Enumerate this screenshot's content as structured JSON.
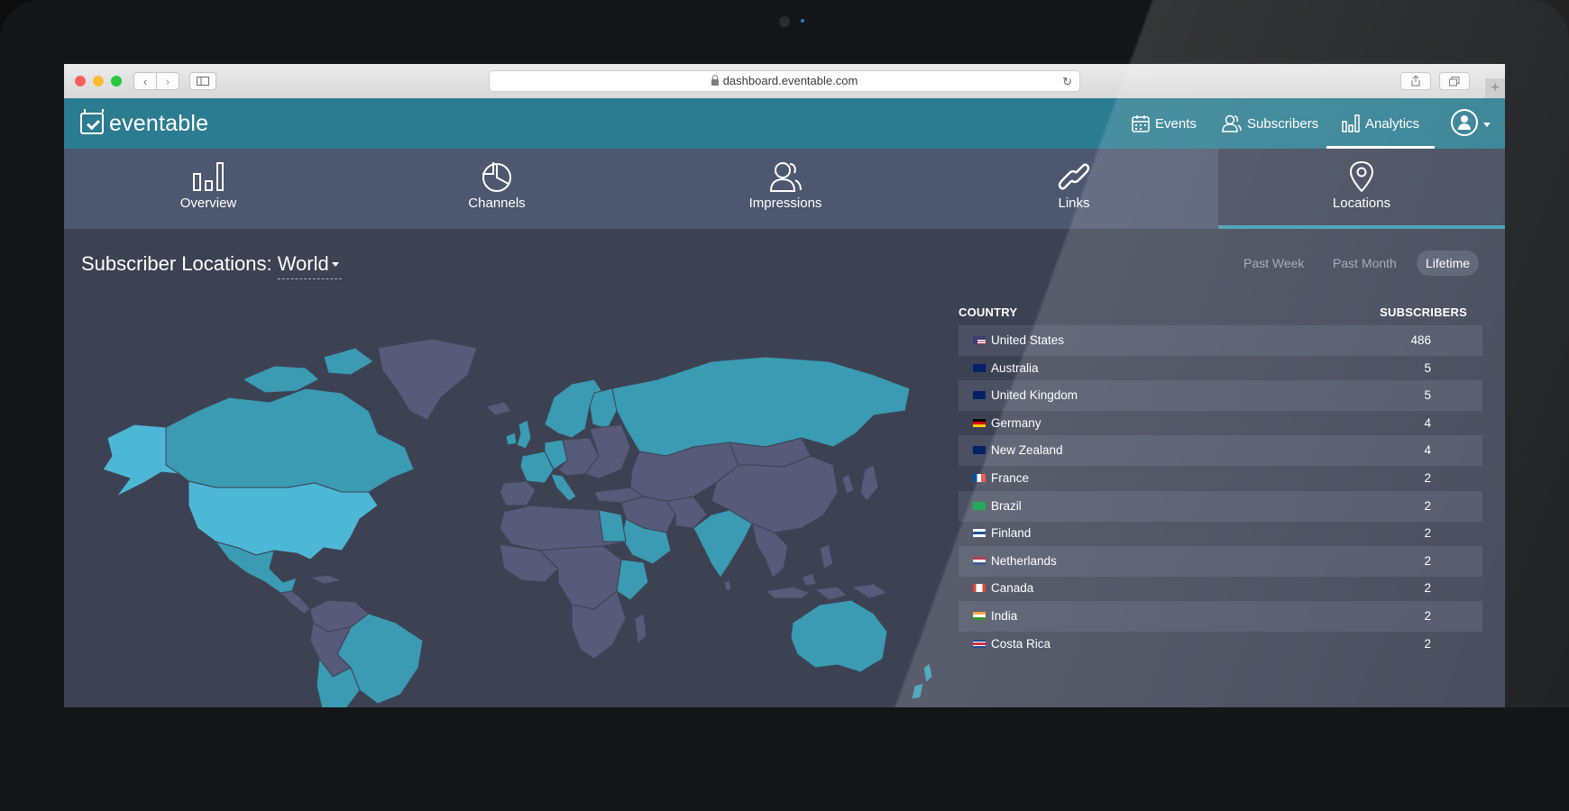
{
  "browser": {
    "url": "dashboard.eventable.com",
    "back_icon": "chevron-left-icon",
    "forward_icon": "chevron-right-icon",
    "new_tab_label": "+"
  },
  "header": {
    "logo_text": "eventable",
    "nav": [
      {
        "label": "Events",
        "icon": "calendar-icon"
      },
      {
        "label": "Subscribers",
        "icon": "users-icon"
      },
      {
        "label": "Analytics",
        "icon": "bar-chart-icon",
        "active": true
      }
    ]
  },
  "tabs": [
    {
      "label": "Overview",
      "icon": "bar-chart-icon"
    },
    {
      "label": "Channels",
      "icon": "pie-chart-icon"
    },
    {
      "label": "Impressions",
      "icon": "users-icon"
    },
    {
      "label": "Links",
      "icon": "link-icon"
    },
    {
      "label": "Locations",
      "icon": "location-pin-icon",
      "active": true
    }
  ],
  "content": {
    "title_prefix": "Subscriber Locations:",
    "region_selected": "World",
    "time_ranges": [
      {
        "label": "Past Week"
      },
      {
        "label": "Past Month"
      },
      {
        "label": "Lifetime",
        "active": true
      }
    ]
  },
  "table": {
    "col_country": "COUNTRY",
    "col_subscribers": "SUBSCRIBERS",
    "rows": [
      {
        "country": "United States",
        "subscribers": "486"
      },
      {
        "country": "Australia",
        "subscribers": "5"
      },
      {
        "country": "United Kingdom",
        "subscribers": "5"
      },
      {
        "country": "Germany",
        "subscribers": "4"
      },
      {
        "country": "New Zealand",
        "subscribers": "4"
      },
      {
        "country": "France",
        "subscribers": "2"
      },
      {
        "country": "Brazil",
        "subscribers": "2"
      },
      {
        "country": "Finland",
        "subscribers": "2"
      },
      {
        "country": "Netherlands",
        "subscribers": "2"
      },
      {
        "country": "Canada",
        "subscribers": "2"
      },
      {
        "country": "India",
        "subscribers": "2"
      },
      {
        "country": "Costa Rica",
        "subscribers": "2"
      }
    ]
  },
  "colors": {
    "header_bg": "#2b7c90",
    "tabs_bg": "#4e5770",
    "content_bg": "#3d4253",
    "map_highlight": "#3a9bb3",
    "map_strong": "#4db8d6",
    "map_land": "#575a78"
  }
}
